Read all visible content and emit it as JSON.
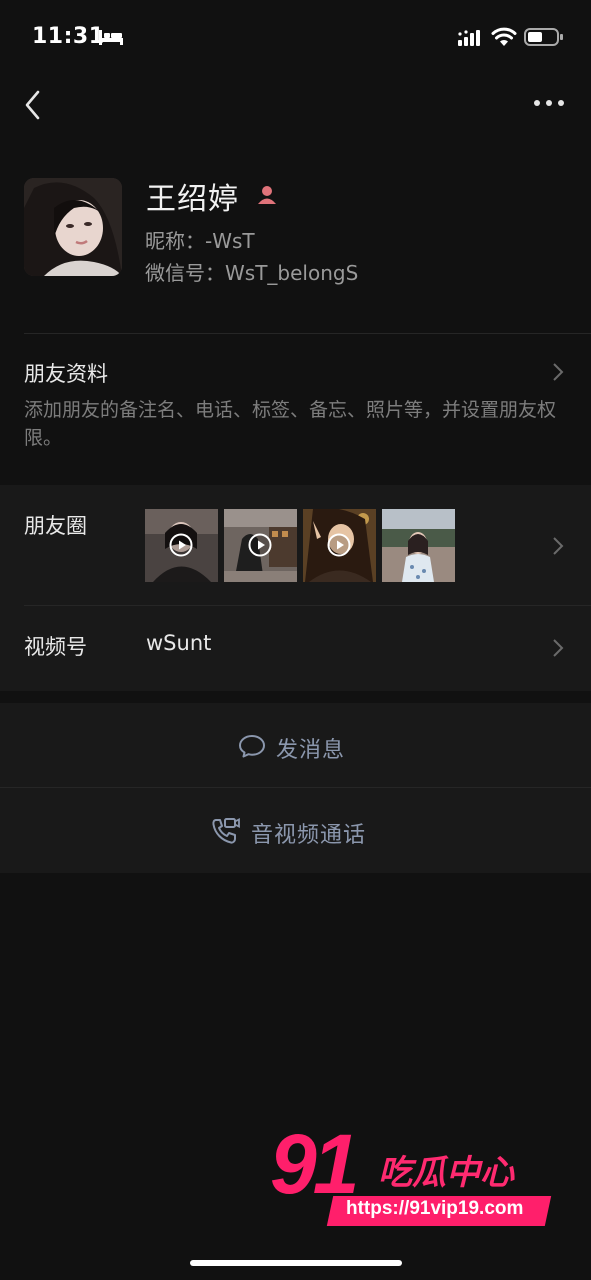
{
  "status_bar": {
    "time": "11:31"
  },
  "profile": {
    "name": "王绍婷",
    "nickname": "昵称：-WsT",
    "wechat_id": "微信号：WsT_belongS",
    "gender_icon_color": "#e0737a"
  },
  "friend_info": {
    "title": "朋友资料",
    "description": "添加朋友的备注名、电话、标签、备忘、照片等，并设置朋友权限。"
  },
  "moments": {
    "label": "朋友圈",
    "thumbnails": [
      {
        "icon": "play-icon",
        "is_video": true
      },
      {
        "icon": "play-icon",
        "is_video": true
      },
      {
        "icon": "play-icon",
        "is_video": true
      },
      {
        "is_video": false
      }
    ]
  },
  "channels": {
    "label": "视频号",
    "value": "wSunt"
  },
  "actions": {
    "message": "发消息",
    "call": "音视频通话",
    "accent_color": "#8b97ad"
  },
  "watermark": {
    "number": "91",
    "text": "吃瓜中心",
    "url": "https://91vip19.com",
    "color": "#ff1f6b"
  }
}
